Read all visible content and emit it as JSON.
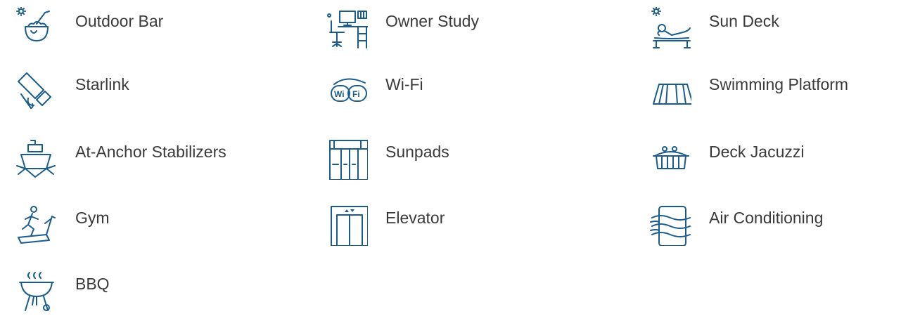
{
  "accent_color": "#1a5c8c",
  "text_color": "#3a3a3a",
  "amenities": [
    {
      "label": "Outdoor Bar",
      "icon": "cocktail-icon"
    },
    {
      "label": "Owner Study",
      "icon": "desk-icon"
    },
    {
      "label": "Sun Deck",
      "icon": "sunbed-icon"
    },
    {
      "label": "Starlink",
      "icon": "satellite-icon"
    },
    {
      "label": "Wi-Fi",
      "icon": "wifi-icon",
      "icon_text": [
        "Wi",
        "Fi"
      ]
    },
    {
      "label": "Swimming Platform",
      "icon": "swim-platform-icon"
    },
    {
      "label": "At-Anchor Stabilizers",
      "icon": "boat-stabilizer-icon"
    },
    {
      "label": "Sunpads",
      "icon": "sunpads-icon"
    },
    {
      "label": "Deck Jacuzzi",
      "icon": "jacuzzi-icon"
    },
    {
      "label": "Gym",
      "icon": "treadmill-icon"
    },
    {
      "label": "Elevator",
      "icon": "elevator-icon"
    },
    {
      "label": "Air Conditioning",
      "icon": "air-conditioning-icon"
    },
    {
      "label": "BBQ",
      "icon": "bbq-grill-icon"
    }
  ]
}
